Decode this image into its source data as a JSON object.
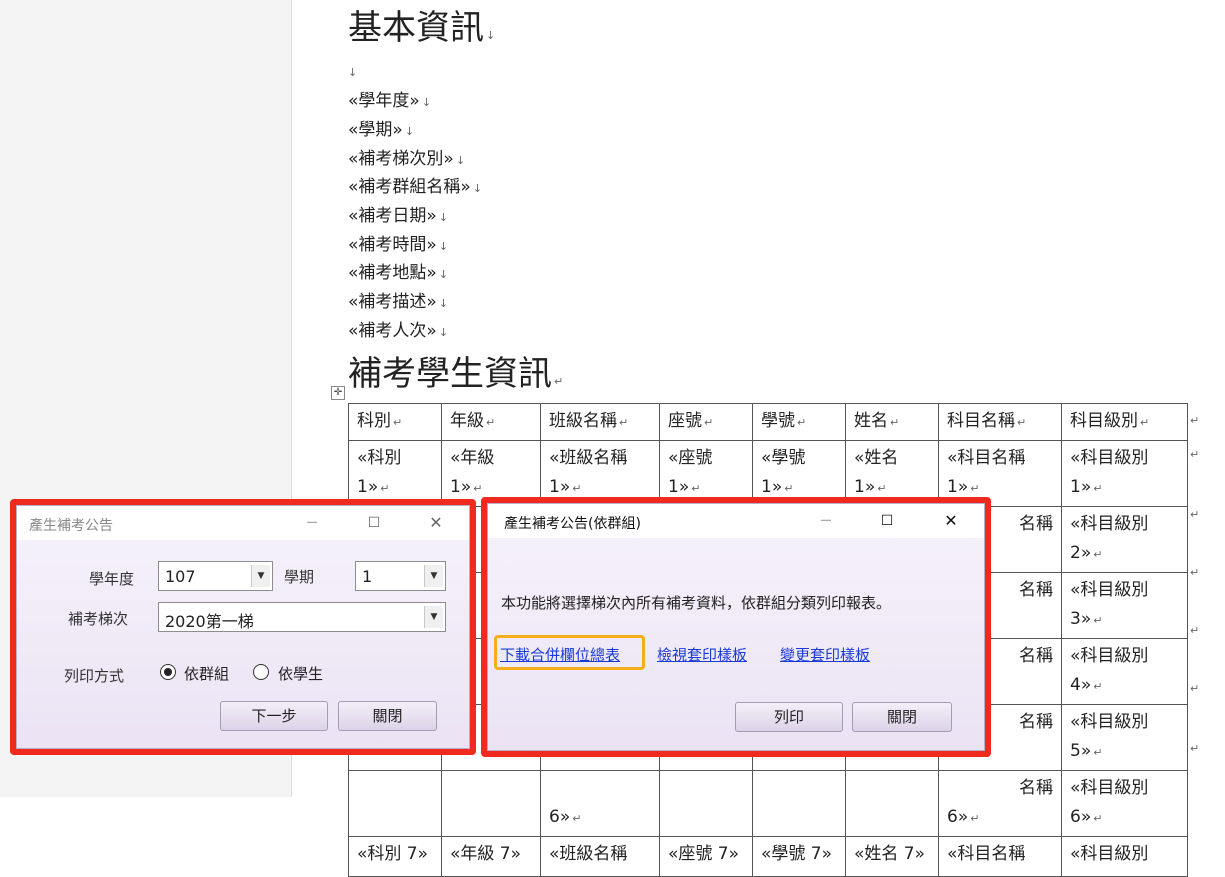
{
  "document": {
    "heading_basic": "基本資訊",
    "fields": [
      "«學年度»",
      "«學期»",
      "«補考梯次別»",
      "«補考群組名稱»",
      "«補考日期»",
      "«補考時間»",
      "«補考地點»",
      "«補考描述»",
      "«補考人次»"
    ],
    "heading_students": "補考學生資訊",
    "table_anchor_icon": "move-cross-icon",
    "table": {
      "headers": [
        "科別",
        "年級",
        "班級名稱",
        "座號",
        "學號",
        "姓名",
        "科目名稱",
        "科目級別"
      ],
      "row1": [
        "«科別 1»",
        "«年級 1»",
        "«班級名稱 1»",
        "«座號 1»",
        "«學號 1»",
        "«姓名 1»",
        "«科目名稱 1»",
        "«科目級別 1»"
      ],
      "partial_rows": [
        {
          "subject": "名稱",
          "level": "«科目級別 2»"
        },
        {
          "subject": "名稱",
          "level": "«科目級別 3»"
        },
        {
          "subject": "名稱",
          "level": "«科目級別 4»"
        },
        {
          "subject": "名稱",
          "level": "«科目級別 5»"
        },
        {
          "subject": "名稱",
          "level": "«科目級別 6»"
        }
      ],
      "row6_class_tail": "6»",
      "row6_subject_tail": "6»",
      "row7": [
        "«科別 7»",
        "«年級 7»",
        "«班級名稱",
        "«座號 7»",
        "«學號 7»",
        "«姓名 7»",
        "«科目名稱",
        "«科目級別"
      ]
    }
  },
  "dialog1": {
    "title": "產生補考公告",
    "year_label": "學年度",
    "year_value": "107",
    "semester_label": "學期",
    "semester_value": "1",
    "round_label": "補考梯次",
    "round_value": "2020第一梯",
    "print_mode_label": "列印方式",
    "radio_by_group": "依群組",
    "radio_by_student": "依學生",
    "selected_mode": "依群組",
    "next_button": "下一步",
    "close_button": "關閉"
  },
  "dialog2": {
    "title": "產生補考公告(依群組)",
    "description": "本功能將選擇梯次內所有補考資料，依群組分類列印報表。",
    "link_download": "下載合併欄位總表",
    "link_view": "檢視套印樣板",
    "link_change": "變更套印樣板",
    "print_button": "列印",
    "close_button": "關閉"
  },
  "colors": {
    "highlight_frame": "#f02a1e",
    "link_highlight": "#f5ad1a",
    "link": "#1a3ad8"
  }
}
